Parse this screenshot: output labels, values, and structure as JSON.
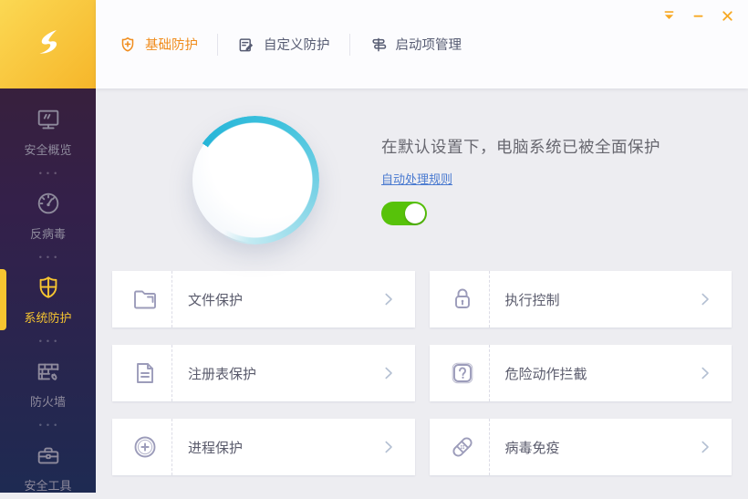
{
  "colors": {
    "accent_orange": "#F08C1C",
    "active_gold": "#F7C530",
    "toggle_green": "#57C20A",
    "link_blue": "#4A7AD0",
    "sidebar_top": "#3A2033",
    "sidebar_bottom": "#1E2A52"
  },
  "window_controls": [
    {
      "id": "tray",
      "icon": "hide-to-tray-icon",
      "symbol": "i-tray"
    },
    {
      "id": "minimize",
      "icon": "minimize-icon",
      "symbol": "i-min"
    },
    {
      "id": "close",
      "icon": "close-icon",
      "symbol": "i-close"
    }
  ],
  "header": {
    "tabs": [
      {
        "id": "basic-protection",
        "label": "基础防护",
        "icon": "shield-plus-icon",
        "symbol": "i-shield-plus",
        "active": true
      },
      {
        "id": "custom-protection",
        "label": "自定义防护",
        "icon": "edit-icon",
        "symbol": "i-edit",
        "active": false
      },
      {
        "id": "startup-management",
        "label": "启动项管理",
        "icon": "signpost-icon",
        "symbol": "i-signpost",
        "active": false
      }
    ]
  },
  "sidebar": {
    "separator_glyph": "•••",
    "items": [
      {
        "id": "security-overview",
        "label": "安全概览",
        "icon": "monitor-icon",
        "symbol": "i-monitor",
        "active": false
      },
      {
        "id": "antivirus",
        "label": "反病毒",
        "icon": "gauge-icon",
        "symbol": "i-gauge",
        "active": false
      },
      {
        "id": "system-protection",
        "label": "系统防护",
        "icon": "shield-cross-icon",
        "symbol": "i-shield-cross",
        "active": true
      },
      {
        "id": "firewall",
        "label": "防火墙",
        "icon": "firewall-icon",
        "symbol": "i-firewall",
        "active": false
      },
      {
        "id": "security-tools",
        "label": "安全工具",
        "icon": "toolbox-icon",
        "symbol": "i-toolbox",
        "active": false
      }
    ]
  },
  "hero": {
    "status_text": "在默认设置下，电脑系统已被全面保护",
    "link_label": "自动处理规则",
    "toggle_state": "on"
  },
  "cards": [
    {
      "id": "file-protection",
      "label": "文件保护",
      "icon": "folder-icon",
      "symbol": "i-folder"
    },
    {
      "id": "execution-control",
      "label": "执行控制",
      "icon": "lock-icon",
      "symbol": "i-lock"
    },
    {
      "id": "registry-protection",
      "label": "注册表保护",
      "icon": "document-icon",
      "symbol": "i-document"
    },
    {
      "id": "dangerous-action-block",
      "label": "危险动作拦截",
      "icon": "question-icon",
      "symbol": "i-question"
    },
    {
      "id": "process-protection",
      "label": "进程保护",
      "icon": "plus-circle-icon",
      "symbol": "i-plus-circle"
    },
    {
      "id": "virus-immunity",
      "label": "病毒免疫",
      "icon": "bandage-icon",
      "symbol": "i-bandage"
    }
  ]
}
